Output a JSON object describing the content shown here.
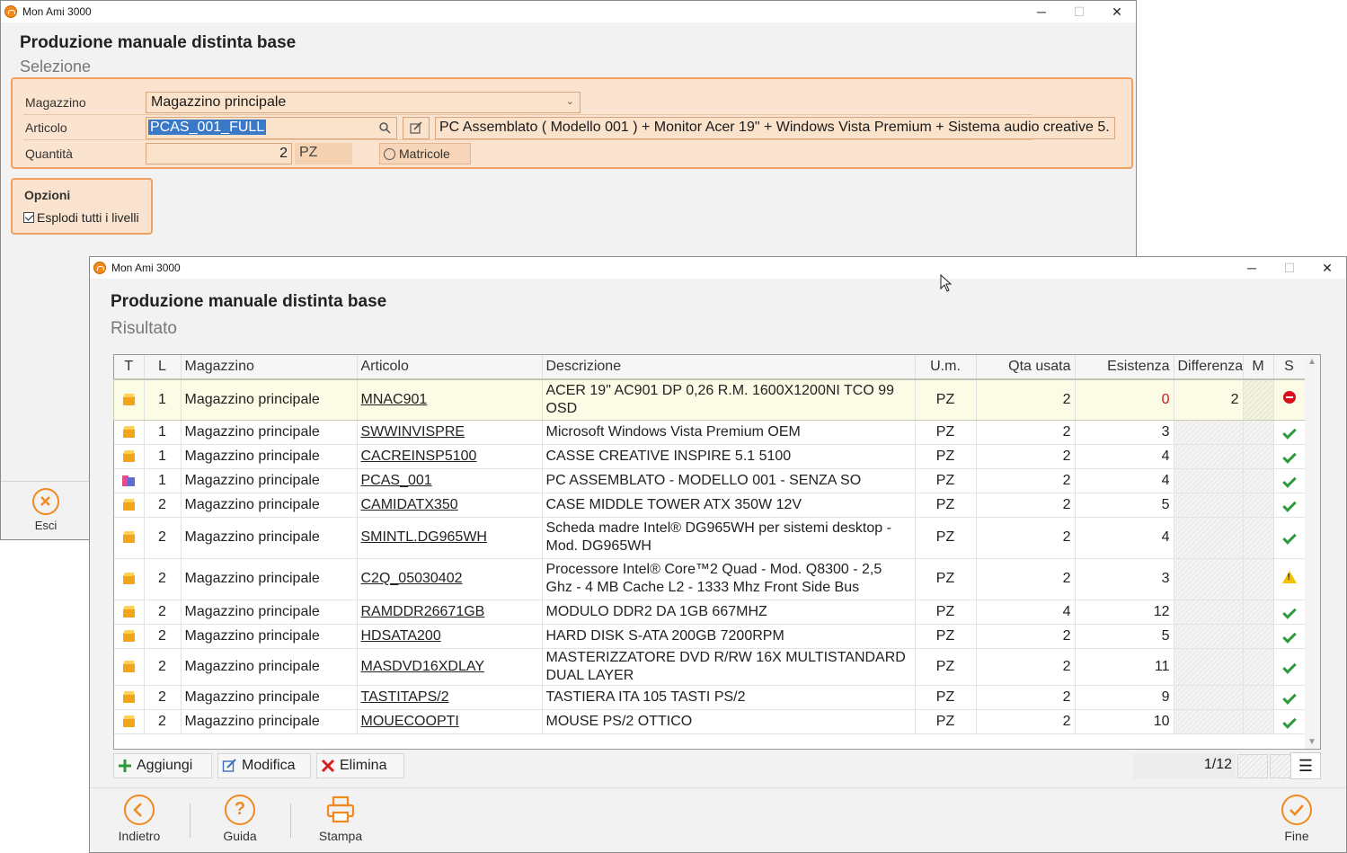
{
  "window1": {
    "app_title": "Mon Ami 3000",
    "title": "Produzione manuale distinta base",
    "subtitle": "Selezione",
    "controls": {
      "minimize": "─",
      "maximize": "☐",
      "close": "✕"
    },
    "selection": {
      "magazzino_label": "Magazzino",
      "magazzino_value": "Magazzino principale",
      "articolo_label": "Articolo",
      "articolo_value": "PCAS_001_FULL",
      "articolo_description": "PC Assemblato ( Modello 001 ) + Monitor Acer 19\" + Windows Vista Premium + Sistema audio creative 5.",
      "quantita_label": "Quantità",
      "quantita_value": "2",
      "um_value": "PZ",
      "matricole_label": "Matricole"
    },
    "options": {
      "title": "Opzioni",
      "explode_label": "Esplodi tutti i livelli"
    },
    "esci_label": "Esci"
  },
  "window2": {
    "app_title": "Mon Ami 3000",
    "title": "Produzione manuale distinta base",
    "subtitle": "Risultato",
    "controls": {
      "minimize": "─",
      "maximize": "☐",
      "close": "✕"
    },
    "columns": [
      "T",
      "L",
      "Magazzino",
      "Articolo",
      "Descrizione",
      "U.m.",
      "Qta usata",
      "Esistenza",
      "Differenza",
      "M",
      "S"
    ],
    "rows": [
      {
        "type": "box",
        "level": "1",
        "magazzino": "Magazzino principale",
        "articolo": "MNAC901",
        "descrizione": "ACER 19\" AC901 DP 0,26 R.M. 1600X1200NI TCO 99 OSD",
        "um": "PZ",
        "qta": "2",
        "esistenza": "0",
        "differenza": "2",
        "status": "error"
      },
      {
        "type": "box",
        "level": "1",
        "magazzino": "Magazzino principale",
        "articolo": "SWWINVISPRE",
        "descrizione": "Microsoft Windows Vista Premium OEM",
        "um": "PZ",
        "qta": "2",
        "esistenza": "3",
        "differenza": "",
        "status": "ok"
      },
      {
        "type": "box",
        "level": "1",
        "magazzino": "Magazzino principale",
        "articolo": "CACREINSP5100",
        "descrizione": "CASSE CREATIVE INSPIRE 5.1 5100",
        "um": "PZ",
        "qta": "2",
        "esistenza": "4",
        "differenza": "",
        "status": "ok"
      },
      {
        "type": "kit",
        "level": "1",
        "magazzino": "Magazzino principale",
        "articolo": "PCAS_001",
        "descrizione": "PC ASSEMBLATO - MODELLO 001 - SENZA SO",
        "um": "PZ",
        "qta": "2",
        "esistenza": "4",
        "differenza": "",
        "status": "ok"
      },
      {
        "type": "box",
        "level": "2",
        "magazzino": "Magazzino principale",
        "articolo": "CAMIDATX350",
        "descrizione": "CASE MIDDLE TOWER ATX  350W 12V",
        "um": "PZ",
        "qta": "2",
        "esistenza": "5",
        "differenza": "",
        "status": "ok"
      },
      {
        "type": "box",
        "level": "2",
        "magazzino": "Magazzino principale",
        "articolo": "SMINTL.DG965WH",
        "descrizione": "Scheda madre Intel® DG965WH per sistemi desktop - Mod. DG965WH",
        "um": "PZ",
        "qta": "2",
        "esistenza": "4",
        "differenza": "",
        "status": "ok"
      },
      {
        "type": "box",
        "level": "2",
        "magazzino": "Magazzino principale",
        "articolo": "C2Q_05030402",
        "descrizione": "Processore Intel® Core™2 Quad - Mod. Q8300 - 2,5 Ghz - 4 MB Cache L2 - 1333 Mhz Front Side Bus",
        "um": "PZ",
        "qta": "2",
        "esistenza": "3",
        "differenza": "",
        "status": "warning"
      },
      {
        "type": "box",
        "level": "2",
        "magazzino": "Magazzino principale",
        "articolo": "RAMDDR26671GB",
        "descrizione": "MODULO DDR2 DA 1GB 667MHZ",
        "um": "PZ",
        "qta": "4",
        "esistenza": "12",
        "differenza": "",
        "status": "ok"
      },
      {
        "type": "box",
        "level": "2",
        "magazzino": "Magazzino principale",
        "articolo": "HDSATA200",
        "descrizione": "HARD DISK S-ATA 200GB 7200RPM",
        "um": "PZ",
        "qta": "2",
        "esistenza": "5",
        "differenza": "",
        "status": "ok"
      },
      {
        "type": "box",
        "level": "2",
        "magazzino": "Magazzino principale",
        "articolo": "MASDVD16XDLAY",
        "descrizione": "MASTERIZZATORE DVD R/RW 16X MULTISTANDARD DUAL LAYER",
        "um": "PZ",
        "qta": "2",
        "esistenza": "11",
        "differenza": "",
        "status": "ok"
      },
      {
        "type": "box",
        "level": "2",
        "magazzino": "Magazzino principale",
        "articolo": "TASTITAPS/2",
        "descrizione": "TASTIERA ITA 105 TASTI PS/2",
        "um": "PZ",
        "qta": "2",
        "esistenza": "9",
        "differenza": "",
        "status": "ok"
      },
      {
        "type": "box",
        "level": "2",
        "magazzino": "Magazzino principale",
        "articolo": "MOUECOOPTI",
        "descrizione": "MOUSE PS/2 OTTICO",
        "um": "PZ",
        "qta": "2",
        "esistenza": "10",
        "differenza": "",
        "status": "ok"
      }
    ],
    "actions": {
      "add": "Aggiungi",
      "edit": "Modifica",
      "delete": "Elimina"
    },
    "pager": "1/12",
    "footer": {
      "back": "Indietro",
      "help": "Guida",
      "print": "Stampa",
      "finish": "Fine"
    }
  }
}
